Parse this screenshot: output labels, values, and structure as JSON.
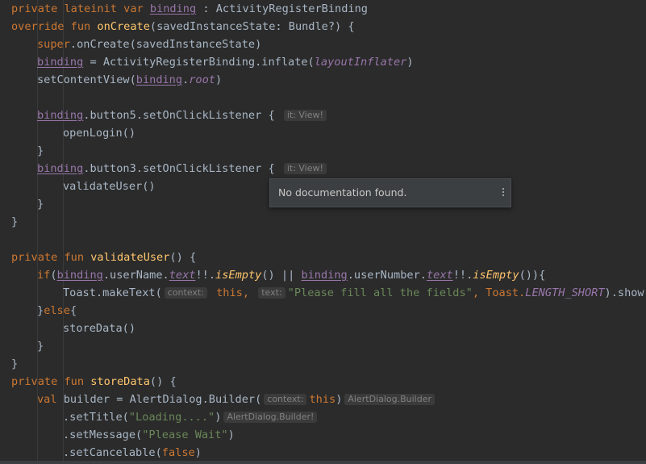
{
  "code": {
    "l1": {
      "a": "private lateinit var ",
      "b": "binding",
      "c": " : ActivityRegisterBinding"
    },
    "l2": {
      "a": "override fun ",
      "b": "onCreate",
      "c": "(savedInstanceState: Bundle?) {"
    },
    "l3": {
      "a": "super",
      "b": ".onCreate(savedInstanceState)"
    },
    "l4": {
      "a": "binding",
      "b": " = ActivityRegisterBinding.inflate(",
      "c": "layoutInflater",
      "d": ")"
    },
    "l5": {
      "a": "setContentView(",
      "b": "binding",
      "c": ".",
      "d": "root",
      "e": ")"
    },
    "l6": {
      "a": "binding",
      "b": ".button5.setOnClickListener { ",
      "hint": "it: View!"
    },
    "l7": "openLogin()",
    "l8": "}",
    "l9": {
      "a": "binding",
      "b": ".button3.setOnClickListener { ",
      "hint": "it: View!"
    },
    "l10": "validateUser()",
    "l11": "}",
    "l12": "}",
    "l13": {
      "a": "private fun ",
      "b": "validateUser",
      "c": "() {"
    },
    "l14": {
      "a": "if",
      "b": "(",
      "c": "binding",
      ".d": ".",
      "e": "userName",
      "f": ".",
      "g": "text",
      "h": "!!.",
      "i": "isEmpty",
      "j": "() || ",
      "k": "binding",
      "l": ".userNumber.",
      "m": "text",
      "n": "!!.",
      "o": "isEmpty",
      "p": "()){"
    },
    "l15": {
      "a": "Toast.makeText(",
      "h1": "context:",
      "b": " this,",
      "c": " ",
      "h2": "text:",
      "d": "\"Please fill all the fields\"",
      "e": ", Toast.",
      "f": "LENGTH_SHORT",
      "g": ").show()"
    },
    "l16": {
      "a": "}",
      "b": "else",
      "c": "{"
    },
    "l17": "storeData()",
    "l18": "}",
    "l19": "}",
    "l20": {
      "a": "private fun ",
      "b": "storeData",
      "c": "() {"
    },
    "l21": {
      "a": "val ",
      "b": "builder = AlertDialog.Builder(",
      "h1": "context:",
      "c": "this",
      "d": ")",
      "h2": "AlertDialog.Builder"
    },
    "l22": {
      "a": ".setTitle(",
      "b": "\"Loading....\"",
      "c": ")",
      "h": "AlertDialog.Builder!"
    },
    "l23": {
      "a": ".setMessage(",
      "b": "\"Please Wait\"",
      "c": ")"
    },
    "l24": {
      "a": ".setCancelable(",
      "b": "false",
      "c": ")"
    }
  },
  "popup": {
    "text": "No documentation found.",
    "menu_icon": "more-vertical-icon"
  }
}
